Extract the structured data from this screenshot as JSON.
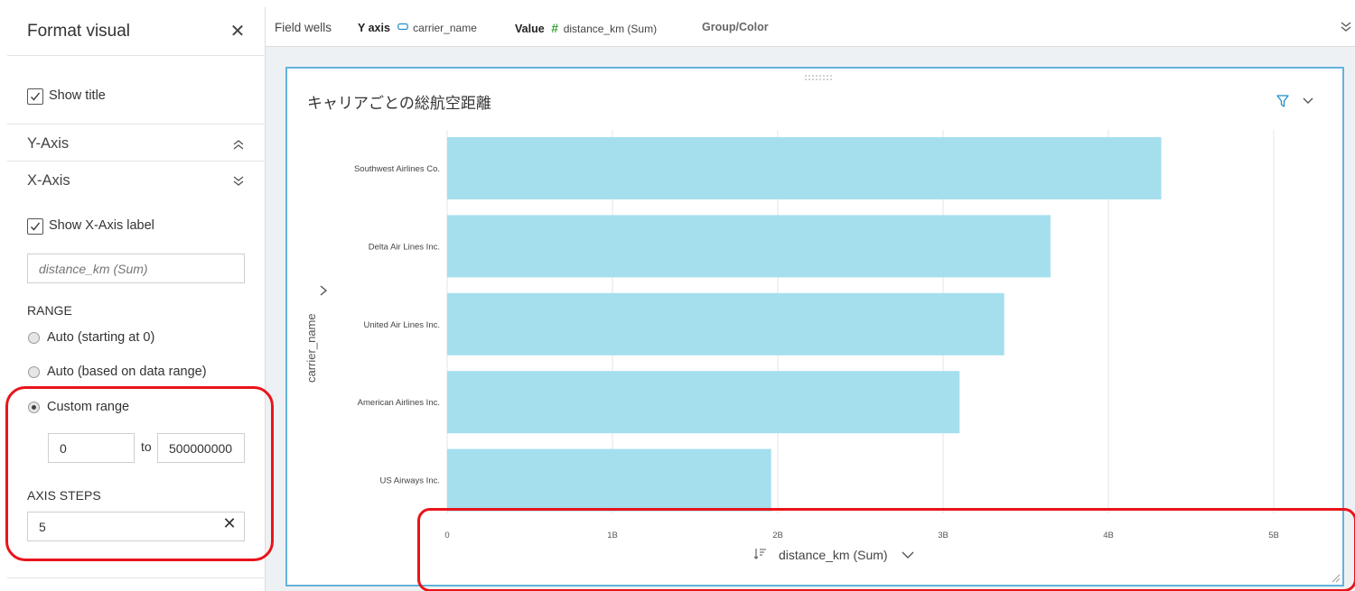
{
  "format_panel": {
    "title": "Format visual",
    "close_icon": "close-icon",
    "show_title_label": "Show title",
    "show_title_checked": true,
    "y_axis_section": "Y-Axis",
    "y_axis_expanded": false,
    "x_axis_section": "X-Axis",
    "x_axis_expanded": true,
    "show_x_axis_label": "Show X-Axis label",
    "show_x_axis_label_checked": true,
    "x_axis_label_placeholder": "distance_km (Sum)",
    "range_title": "RANGE",
    "range_options": [
      "Auto (starting at 0)",
      "Auto (based on data range)",
      "Custom range"
    ],
    "range_selected": "Custom range",
    "custom_min": "0",
    "custom_max": "500000000",
    "to_label": "to",
    "axis_steps_title": "AXIS STEPS",
    "axis_steps_value": "5"
  },
  "field_wells": {
    "label": "Field wells",
    "y_axis_key": "Y axis",
    "y_axis_icon": "dimension-icon",
    "y_axis_value": "carrier_name",
    "value_key": "Value",
    "value_icon": "measure-hash-icon",
    "value_value": "distance_km (Sum)",
    "group_color_key": "Group/Color"
  },
  "visual": {
    "title": "キャリアごとの総航空距離",
    "y_axis_title": "carrier_name",
    "x_axis_title": "distance_km (Sum)"
  },
  "colors": {
    "bar": "#a5dfee",
    "visual_border": "#62b3dd",
    "highlight": "#e8141b",
    "measure_icon": "#3aa537",
    "dimension_icon": "#1e90c9"
  },
  "chart_data": {
    "type": "bar",
    "orientation": "horizontal",
    "title": "キャリアごとの総航空距離",
    "xlabel": "distance_km (Sum)",
    "ylabel": "carrier_name",
    "categories": [
      "Southwest Airlines Co.",
      "Delta Air Lines Inc.",
      "United Air Lines Inc.",
      "American Airlines Inc.",
      "US Airways Inc."
    ],
    "values": [
      4320000000,
      3650000000,
      3370000000,
      3100000000,
      1960000000
    ],
    "xlim": [
      0,
      5000000000
    ],
    "x_ticks": [
      0,
      1000000000,
      2000000000,
      3000000000,
      4000000000,
      5000000000
    ],
    "x_tick_labels": [
      "0",
      "1B",
      "2B",
      "3B",
      "4B",
      "5B"
    ],
    "grid": true
  }
}
